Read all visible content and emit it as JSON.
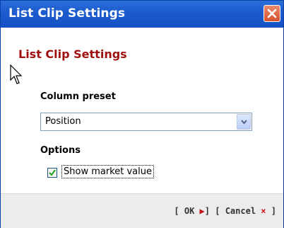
{
  "window": {
    "title": "List Clip Settings",
    "heading": "List Clip Settings"
  },
  "column_preset": {
    "label": "Column preset",
    "selected": "Position"
  },
  "options": {
    "label": "Options",
    "show_market_value": {
      "label": "Show market value",
      "checked": true
    }
  },
  "footer": {
    "ok": {
      "open": "[",
      "label": "OK",
      "icon": "▶",
      "close": "]"
    },
    "cancel": {
      "open": "[",
      "label": "Cancel",
      "icon": "×",
      "close": "]"
    }
  },
  "colors": {
    "titlebar": "#1c5ccf",
    "heading": "#a00f0f",
    "accent_red": "#c0101a"
  }
}
